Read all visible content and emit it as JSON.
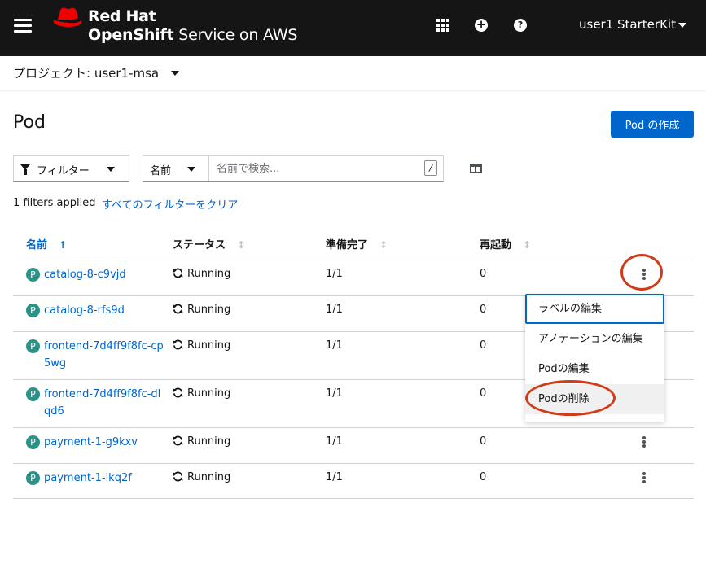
{
  "masthead": {
    "brand_line1": "Red Hat",
    "brand_line2_bold": "OpenShift",
    "brand_line2_rest": " Service on AWS",
    "user_label": "user1 StarterKit",
    "icons": [
      "hamburger-icon",
      "app-launcher-icon",
      "add-icon",
      "help-icon"
    ]
  },
  "project_bar": {
    "label": "プロジェクト: user1-msa"
  },
  "page": {
    "title": "Pod",
    "create_button": "Pod の作成"
  },
  "toolbar": {
    "filter_label": "フィルター",
    "search_type": "名前",
    "search_placeholder": "名前で検索...",
    "search_shortcut": "/",
    "filters_applied": "1 filters applied",
    "clear_filters": "すべてのフィルターをクリア"
  },
  "table": {
    "columns": [
      "名前",
      "ステータス",
      "準備完了",
      "再起動"
    ],
    "rows": [
      {
        "name": "catalog-8-c9vjd",
        "badge": "P",
        "status": "Running",
        "ready": "1/1",
        "restarts": "0"
      },
      {
        "name": "catalog-8-rfs9d",
        "badge": "P",
        "status": "Running",
        "ready": "1/1",
        "restarts": "0"
      },
      {
        "name": "frontend-7d4ff9f8fc-cp5wg",
        "badge": "P",
        "status": "Running",
        "ready": "1/1",
        "restarts": "0"
      },
      {
        "name": "frontend-7d4ff9f8fc-dlqd6",
        "badge": "P",
        "status": "Running",
        "ready": "1/1",
        "restarts": "0"
      },
      {
        "name": "payment-1-g9kxv",
        "badge": "P",
        "status": "Running",
        "ready": "1/1",
        "restarts": "0"
      },
      {
        "name": "payment-1-lkq2f",
        "badge": "P",
        "status": "Running",
        "ready": "1/1",
        "restarts": "0"
      }
    ]
  },
  "kebab_menu": {
    "items": [
      "ラベルの編集",
      "アノテーションの編集",
      "Podの編集",
      "Podの削除"
    ],
    "focused_item": "ラベルの編集",
    "hovered_item": "Podの削除"
  },
  "colors": {
    "masthead": "#151515",
    "link": "#0066cc",
    "badge": "#2a9287",
    "annotation": "#cf3c1a"
  }
}
